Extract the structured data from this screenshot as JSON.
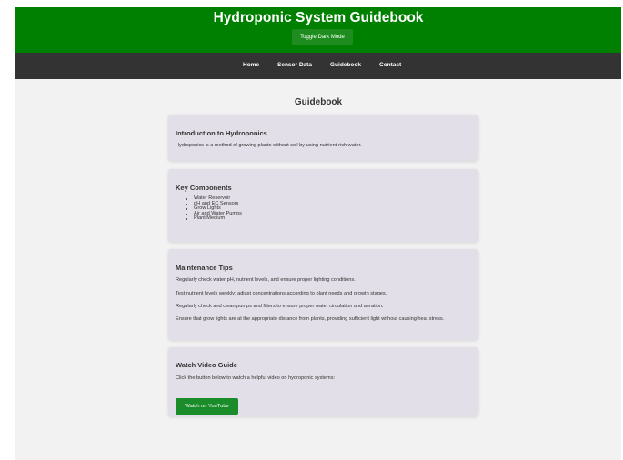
{
  "header": {
    "title": "Hydroponic System Guidebook",
    "dark_mode_label": "Toggle Dark Mode"
  },
  "nav": {
    "items": [
      {
        "label": "Home"
      },
      {
        "label": "Sensor Data"
      },
      {
        "label": "Guidebook"
      },
      {
        "label": "Contact"
      }
    ]
  },
  "main": {
    "title": "Guidebook",
    "intro": {
      "heading": "Introduction to Hydroponics",
      "text": "Hydroponics is a method of growing plants without soil by using nutrient-rich water."
    },
    "components": {
      "heading": "Key Components",
      "items": [
        "Water Reservoir",
        "pH and EC Sensors",
        "Grow Lights",
        "Air and Water Pumps",
        "Plant Medium"
      ]
    },
    "maintenance": {
      "heading": "Maintenance Tips",
      "tips": [
        "Regularly check water pH, nutrient levels, and ensure proper lighting conditions.",
        "Test nutrient levels weekly; adjust concentrations according to plant needs and growth stages.",
        "Regularly check and clean pumps and filters to ensure proper water circulation and aeration.",
        "Ensure that grow lights are at the appropriate distance from plants, providing sufficient light without causing heat stress."
      ]
    },
    "video": {
      "heading": "Watch Video Guide",
      "text": "Click the button below to watch a helpful video on hydroponic systems:",
      "button_label": "Watch on YouTube"
    }
  },
  "colors": {
    "header_bg": "#008000",
    "nav_bg": "#333333",
    "card_bg": "#e3dfe8",
    "button_bg": "#1a8c2a"
  }
}
